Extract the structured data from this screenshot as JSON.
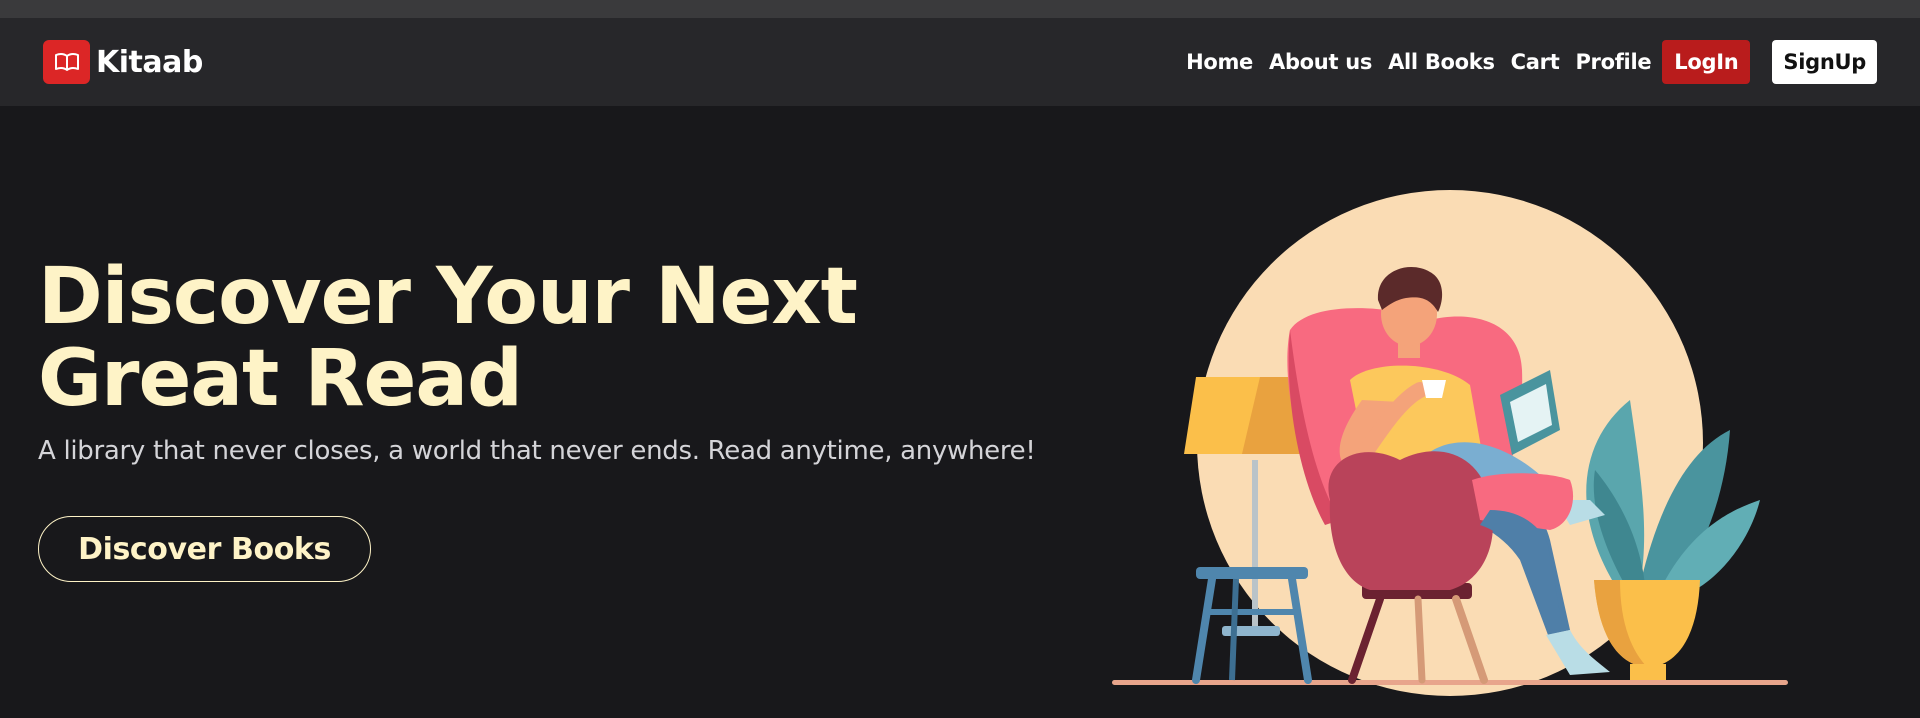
{
  "brand": {
    "name": "Kitaab",
    "icon": "book-open-icon"
  },
  "nav": {
    "links": [
      "Home",
      "About us",
      "All Books",
      "Cart",
      "Profile"
    ],
    "login_label": "LogIn",
    "signup_label": "SignUp"
  },
  "hero": {
    "title": "Discover Your Next Great Read",
    "subtitle": "A library that never closes, a world that never ends. Read anytime, anywhere!",
    "cta_label": "Discover Books",
    "illustration": "person-reading-in-armchair"
  },
  "colors": {
    "page_bg": "#18181b",
    "navbar_bg": "#27272a",
    "brand_red": "#dc2626",
    "login_red": "#b91c1c",
    "title_cream": "#fef3c7",
    "subtitle_gray": "#d4d4d8"
  }
}
